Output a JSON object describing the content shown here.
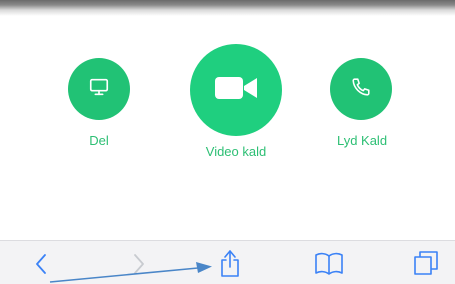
{
  "actions": {
    "share_label": "Del",
    "video_label": "Video kald",
    "audio_label": "Lyd Kald"
  },
  "icons": {
    "share": "monitor-icon",
    "video": "video-camera-icon",
    "audio": "phone-icon",
    "back": "chevron-left-icon",
    "forward": "chevron-right-icon",
    "share_sheet": "share-icon",
    "bookmarks": "book-icon",
    "tabs": "tabs-icon"
  },
  "colors": {
    "accent": "#21c275",
    "label": "#2dbf74",
    "toolbar_icon": "#3b82f6",
    "annotation_arrow": "#4a86c8"
  }
}
